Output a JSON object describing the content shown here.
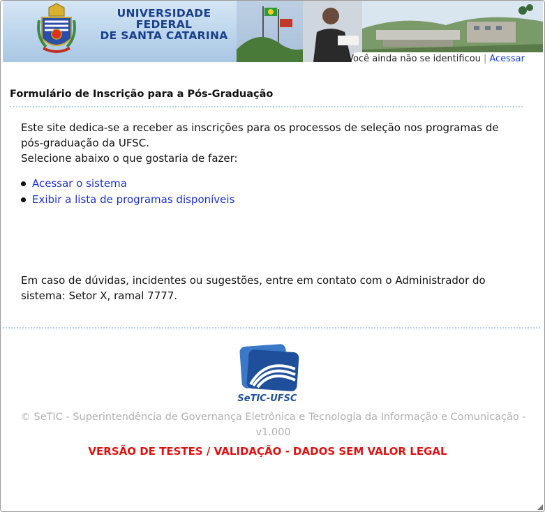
{
  "header": {
    "university_line1": "UNIVERSIDADE FEDERAL",
    "university_line2": "DE SANTA CATARINA",
    "login_status": "Você ainda não se identificou",
    "separator": "|",
    "login_link": "Acessar"
  },
  "main": {
    "title": "Formulário de Inscrição para a Pós-Graduação",
    "intro_line1": "Este site dedica-se a receber as inscrições para os processos de seleção nos programas de pós-graduação da UFSC.",
    "intro_line2": "Selecione abaixo o que gostaria de fazer:",
    "links": [
      {
        "label": "Acessar o sistema"
      },
      {
        "label": "Exibir a lista de programas disponíveis"
      }
    ],
    "contact": "Em caso de dúvidas, incidentes ou sugestões, entre em contato com o Administrador do sistema: Setor X, ramal 7777."
  },
  "footer": {
    "logo_text": "SeTIC-UFSC",
    "copyright": "© SeTIC - Superintendência de Governança Eletrônica e Tecnologia da Informação e Comunicação - v1.000",
    "warning": "VERSÃO DE TESTES / VALIDAÇÃO - DADOS SEM VALOR LEGAL"
  },
  "colors": {
    "link": "#1a2fd0",
    "warning": "#e01010",
    "university_name": "#1a3f8a",
    "copyright": "#b0b0b0"
  },
  "icons": [
    "ufsc-crest-icon",
    "setic-logo-icon"
  ]
}
